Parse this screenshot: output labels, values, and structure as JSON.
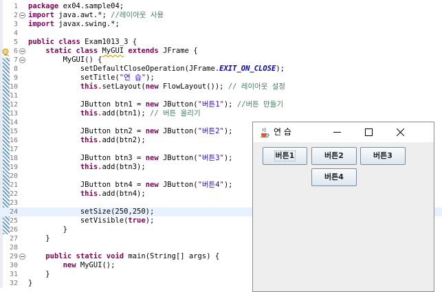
{
  "editor": {
    "lines": [
      {
        "no": "1",
        "fold": false,
        "tokens": [
          [
            "kw",
            "package"
          ],
          [
            "t",
            " ex04.sample04;"
          ]
        ]
      },
      {
        "no": "2",
        "fold": true,
        "tokens": [
          [
            "kw",
            "import"
          ],
          [
            "t",
            " java.awt.*; "
          ],
          [
            "cm",
            "//레이아웃 사용"
          ]
        ]
      },
      {
        "no": "3",
        "fold": false,
        "tokens": [
          [
            "kw",
            "import"
          ],
          [
            "t",
            " javax.swing.*;"
          ]
        ]
      },
      {
        "no": "4",
        "fold": false,
        "tokens": []
      },
      {
        "no": "5",
        "fold": false,
        "tokens": [
          [
            "kw",
            "public class"
          ],
          [
            "t",
            " Exam1013_3 {"
          ]
        ]
      },
      {
        "no": "6",
        "fold": true,
        "tokens": [
          [
            "t",
            "    "
          ],
          [
            "kw",
            "static class"
          ],
          [
            "t",
            " "
          ],
          [
            "ul",
            "MyGUI"
          ],
          [
            "t",
            " "
          ],
          [
            "kw",
            "extends"
          ],
          [
            "t",
            " JFrame {"
          ]
        ]
      },
      {
        "no": "7",
        "fold": true,
        "tokens": [
          [
            "t",
            "        MyGUI() {"
          ]
        ]
      },
      {
        "no": "8",
        "fold": false,
        "tokens": [
          [
            "t",
            "            setDefaultCloseOperation(JFrame."
          ],
          [
            "const",
            "EXIT_ON_CLOSE"
          ],
          [
            "t",
            ");"
          ]
        ]
      },
      {
        "no": "9",
        "fold": false,
        "tokens": [
          [
            "t",
            "            setTitle("
          ],
          [
            "str",
            "\"연 습\""
          ],
          [
            "t",
            ");"
          ]
        ]
      },
      {
        "no": "10",
        "fold": false,
        "tokens": [
          [
            "t",
            "            "
          ],
          [
            "kw",
            "this"
          ],
          [
            "t",
            ".setLayout("
          ],
          [
            "kw",
            "new"
          ],
          [
            "t",
            " FlowLayout()); "
          ],
          [
            "cm",
            "// 레이아웃 설정"
          ]
        ]
      },
      {
        "no": "11",
        "fold": false,
        "tokens": []
      },
      {
        "no": "12",
        "fold": false,
        "tokens": [
          [
            "t",
            "            JButton btn1 = "
          ],
          [
            "kw",
            "new"
          ],
          [
            "t",
            " JButton("
          ],
          [
            "str",
            "\"버튼1\""
          ],
          [
            "t",
            "); "
          ],
          [
            "cm",
            "//버튼 만들기"
          ]
        ]
      },
      {
        "no": "13",
        "fold": false,
        "tokens": [
          [
            "t",
            "            "
          ],
          [
            "kw",
            "this"
          ],
          [
            "t",
            ".add(btn1); "
          ],
          [
            "cm",
            "// 버튼 올리기"
          ]
        ]
      },
      {
        "no": "14",
        "fold": false,
        "tokens": []
      },
      {
        "no": "15",
        "fold": false,
        "tokens": [
          [
            "t",
            "            JButton btn2 = "
          ],
          [
            "kw",
            "new"
          ],
          [
            "t",
            " JButton("
          ],
          [
            "str",
            "\"버튼2\""
          ],
          [
            "t",
            ");"
          ]
        ]
      },
      {
        "no": "16",
        "fold": false,
        "tokens": [
          [
            "t",
            "            "
          ],
          [
            "kw",
            "this"
          ],
          [
            "t",
            ".add(btn2);"
          ]
        ]
      },
      {
        "no": "17",
        "fold": false,
        "tokens": []
      },
      {
        "no": "18",
        "fold": false,
        "tokens": [
          [
            "t",
            "            JButton btn3 = "
          ],
          [
            "kw",
            "new"
          ],
          [
            "t",
            " JButton("
          ],
          [
            "str",
            "\"버튼3\""
          ],
          [
            "t",
            ");"
          ]
        ]
      },
      {
        "no": "19",
        "fold": false,
        "tokens": [
          [
            "t",
            "            "
          ],
          [
            "kw",
            "this"
          ],
          [
            "t",
            ".add(btn3);"
          ]
        ]
      },
      {
        "no": "20",
        "fold": false,
        "tokens": []
      },
      {
        "no": "21",
        "fold": false,
        "tokens": [
          [
            "t",
            "            JButton btn4 = "
          ],
          [
            "kw",
            "new"
          ],
          [
            "t",
            " JButton("
          ],
          [
            "str",
            "\"버튼4\""
          ],
          [
            "t",
            ");"
          ]
        ]
      },
      {
        "no": "22",
        "fold": false,
        "tokens": [
          [
            "t",
            "            "
          ],
          [
            "kw",
            "this"
          ],
          [
            "t",
            ".add(btn4);"
          ]
        ]
      },
      {
        "no": "23",
        "fold": false,
        "tokens": []
      },
      {
        "no": "24",
        "fold": false,
        "current": true,
        "tokens": [
          [
            "t",
            "            setSize(250,250);"
          ]
        ]
      },
      {
        "no": "25",
        "fold": false,
        "tokens": [
          [
            "t",
            "            setVisible("
          ],
          [
            "kw",
            "true"
          ],
          [
            "t",
            ");"
          ]
        ]
      },
      {
        "no": "26",
        "fold": false,
        "tokens": [
          [
            "t",
            "        }"
          ]
        ]
      },
      {
        "no": "27",
        "fold": false,
        "tokens": [
          [
            "t",
            "    }"
          ]
        ]
      },
      {
        "no": "28",
        "fold": false,
        "tokens": []
      },
      {
        "no": "29",
        "fold": true,
        "tokens": [
          [
            "t",
            "    "
          ],
          [
            "kw",
            "public static void"
          ],
          [
            "t",
            " main(String[] args) {"
          ]
        ]
      },
      {
        "no": "30",
        "fold": false,
        "tokens": [
          [
            "t",
            "        "
          ],
          [
            "kw",
            "new"
          ],
          [
            "t",
            " MyGUI();"
          ]
        ]
      },
      {
        "no": "31",
        "fold": false,
        "tokens": [
          [
            "t",
            "    }"
          ]
        ]
      },
      {
        "no": "32",
        "fold": false,
        "tokens": [
          [
            "t",
            "}"
          ]
        ]
      }
    ],
    "colors": {
      "keyword": "#7f0055",
      "string": "#2a00ff",
      "comment": "#3f7f5f",
      "constant": "#0000c0",
      "current_line": "#e8f2fe"
    },
    "warning_icon": "warning-lightbulb-icon"
  },
  "swing_window": {
    "title": "연 습",
    "app_icon": "java-cup-icon",
    "minimize_icon": "minimize-icon",
    "maximize_icon": "maximize-icon",
    "close_icon": "close-icon",
    "buttons": [
      "버튼1",
      "버튼2",
      "버튼3",
      "버튼4"
    ]
  }
}
